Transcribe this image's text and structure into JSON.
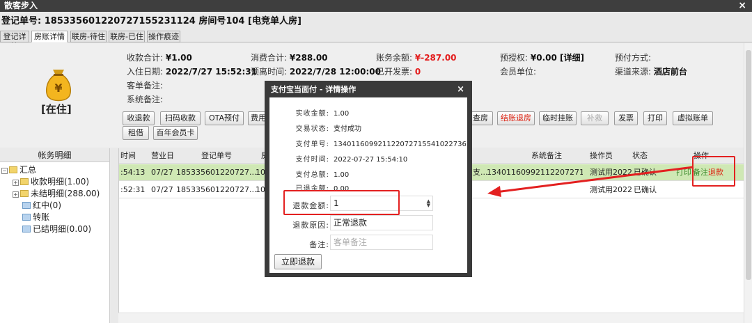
{
  "window": {
    "title": "散客步入",
    "close_glyph": "×"
  },
  "registration": {
    "line": "登记单号: 18533560122072715523112​4 房间号104 [电竞单人房]"
  },
  "tabs": [
    "登记详情",
    "房账详情",
    "联房-待住",
    "联房-已住",
    "操作痕迹"
  ],
  "summary": {
    "status": "[在住]",
    "fields": {
      "received_total": {
        "label": "收款合计:",
        "value": "¥1.00"
      },
      "consume_total": {
        "label": "消费合计:",
        "value": "¥288.00"
      },
      "balance": {
        "label": "账务余额:",
        "value": "¥-287.00"
      },
      "pre_auth": {
        "label": "预授权:",
        "value": "¥0.00 [详细]"
      },
      "prepay_method": {
        "label": "预付方式:",
        "value": ""
      },
      "checkin_date": {
        "label": "入住日期:",
        "value": "2022/7/27 15:52:31"
      },
      "checkout_date": {
        "label": "预离时间:",
        "value": "2022/7/28 12:00:00"
      },
      "invoiced": {
        "label": "已开发票:",
        "value": "0"
      },
      "member_unit": {
        "label": "会员单位:",
        "value": ""
      },
      "channel": {
        "label": "渠道来源:",
        "value": "酒店前台"
      },
      "guest_note": {
        "label": "客单备注:",
        "value": ""
      },
      "system_note": {
        "label": "系统备注:",
        "value": ""
      }
    }
  },
  "buttons": {
    "row1_left": [
      "收退款",
      "扫码收款",
      "OTA预付",
      "费用"
    ],
    "row1_right": [
      "查房",
      "结账退房",
      "临时挂账",
      "补救",
      "发票",
      "打印",
      "虚拟账单"
    ],
    "row2": [
      "租借",
      "百年会员卡"
    ]
  },
  "left_panel": {
    "header": "帐务明细",
    "tree": [
      "汇总",
      "收款明细(1.00)",
      "未结明细(288.00)",
      "红中(0)",
      "转账",
      "已结明细(0.00)"
    ]
  },
  "grid": {
    "headers": [
      "时间",
      "营业日",
      "登记单号",
      "房间",
      "系统备注",
      "操作员",
      "状态",
      "操作"
    ],
    "rows": [
      {
        "time": ":54:13",
        "day": "07/27",
        "reg": "185335601220727...",
        "room": "104",
        "pay": "支...",
        "note": "134011609921122072715541​0...",
        "operator": "测试用2022",
        "status": "已确认",
        "actions": [
          "打印",
          "备注",
          "退款"
        ]
      },
      {
        "time": ":52:31",
        "day": "07/27",
        "reg": "185335601220727...",
        "room": "104",
        "pay": "",
        "note": "",
        "operator": "测试用2022",
        "status": "已确认",
        "actions": []
      }
    ]
  },
  "dialog": {
    "title": "支付宝当面付 - 详情操作",
    "close_glyph": "×",
    "details": [
      {
        "label": "实收金额:",
        "value": "1.00"
      },
      {
        "label": "交易状态:",
        "value": "支付成功"
      },
      {
        "label": "支付单号:",
        "value": "134011609921122072715541022736"
      },
      {
        "label": "支付时间:",
        "value": "2022-07-27 15:54:10"
      },
      {
        "label": "支付总额:",
        "value": "1.00"
      },
      {
        "label": "已退金额:",
        "value": "0.00"
      }
    ],
    "refund_amount": {
      "label": "退款金额:",
      "value": "1"
    },
    "refund_reason": {
      "label": "退款原因:",
      "value": "正常退款"
    },
    "remark": {
      "label": "备注:",
      "placeholder": "客单备注"
    },
    "submit": "立即退款"
  },
  "colors": {
    "accent_red": "#e32020",
    "selected_row": "#cfe8b4",
    "titlebar": "#3e3e3e"
  }
}
